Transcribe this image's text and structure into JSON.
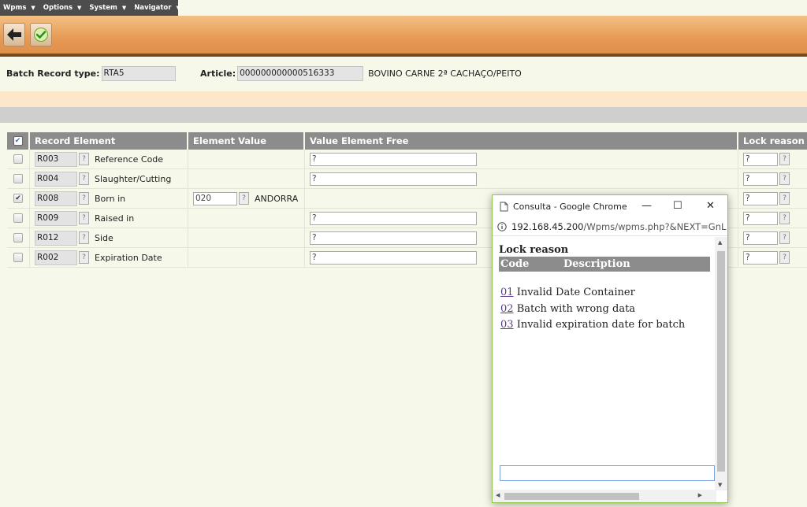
{
  "menu": [
    {
      "label": "Wpms"
    },
    {
      "label": "Options"
    },
    {
      "label": "System"
    },
    {
      "label": "Navigator"
    }
  ],
  "header": {
    "batch_label": "Batch Record type:",
    "batch_value": "RTA5",
    "article_label": "Article:",
    "article_value": "000000000000516333",
    "article_desc": "BOVINO CARNE 2ª CACHAÇO/PEITO"
  },
  "table": {
    "columns": [
      "Record Element",
      "Element Value",
      "Value Element Free",
      "Lock reason"
    ],
    "rows": [
      {
        "code": "R003",
        "name": "Reference Code",
        "checked": false,
        "value": "",
        "value_desc": "",
        "free": "?",
        "lock": "?"
      },
      {
        "code": "R004",
        "name": "Slaughter/Cutting",
        "checked": false,
        "value": "",
        "value_desc": "",
        "free": "?",
        "lock": "?"
      },
      {
        "code": "R008",
        "name": "Born in",
        "checked": true,
        "value": "020",
        "value_desc": "ANDORRA",
        "free": "",
        "lock": "?"
      },
      {
        "code": "R009",
        "name": "Raised in",
        "checked": false,
        "value": "",
        "value_desc": "",
        "free": "?",
        "lock": "?"
      },
      {
        "code": "R012",
        "name": "Side",
        "checked": false,
        "value": "",
        "value_desc": "",
        "free": "?",
        "lock": "?"
      },
      {
        "code": "R002",
        "name": "Expiration Date",
        "checked": false,
        "value": "",
        "value_desc": "",
        "free": "?",
        "lock": "?"
      }
    ]
  },
  "popup": {
    "window_title": "Consulta - Google Chrome",
    "url_host": "192.168.45.200",
    "url_path": "/Wpms/wpms.php?&NEXT=GnL",
    "heading": "Lock reason",
    "col_code": "Code",
    "col_desc": "Description",
    "items": [
      {
        "code": "01",
        "desc": "Invalid Date Container"
      },
      {
        "code": "02",
        "desc": "Batch with wrong data"
      },
      {
        "code": "03",
        "desc": "Invalid expiration date for batch"
      }
    ]
  },
  "colors": {
    "accent": "#e79a55",
    "header_grey": "#8c8c8c",
    "popup_border": "#93c44c",
    "link": "#5b3a8f"
  },
  "icons": [
    "back-arrow-icon",
    "checkmark-icon",
    "chevron-down-icon",
    "page-icon",
    "minimize-icon",
    "maximize-icon",
    "close-icon",
    "info-icon"
  ]
}
